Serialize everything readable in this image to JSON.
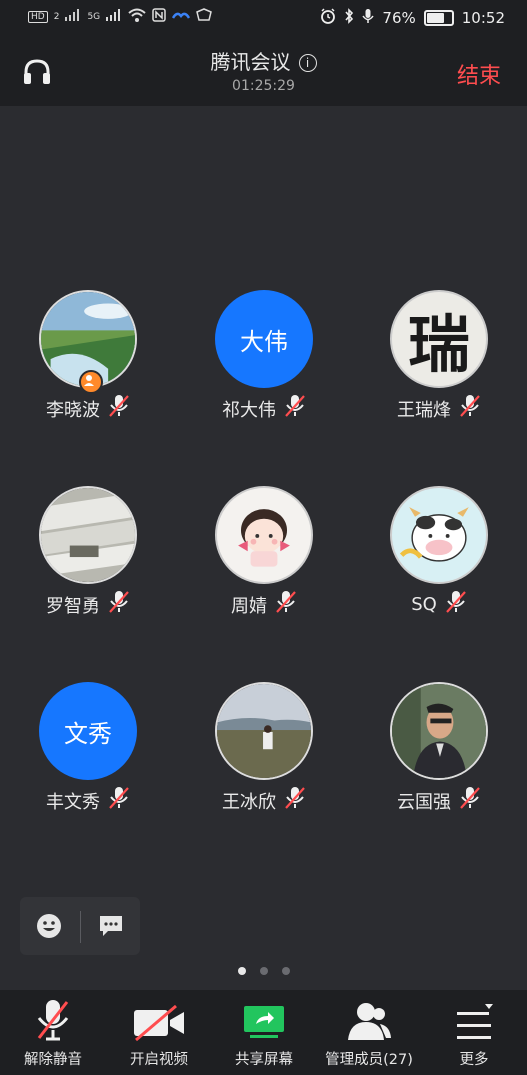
{
  "status_bar": {
    "left": [
      "HD",
      "2",
      "5G"
    ],
    "battery": "76%",
    "battery_level": 0.76,
    "time": "10:52"
  },
  "header": {
    "title": "腾讯会议",
    "timer": "01:25:29",
    "end_label": "结束",
    "info_glyph": "i"
  },
  "participants": [
    {
      "name": "李晓波",
      "avatar": "photo-landscape",
      "host": true
    },
    {
      "name": "祁大伟",
      "avatar_text": "大伟"
    },
    {
      "name": "王瑞烽",
      "avatar": "calligraphy",
      "avatar_text": "瑞"
    },
    {
      "name": "罗智勇",
      "avatar": "photo-greenhouse"
    },
    {
      "name": "周婧",
      "avatar": "cartoon-girl"
    },
    {
      "name": "SQ",
      "avatar": "cartoon-cow"
    },
    {
      "name": "丰文秀",
      "avatar_text": "文秀"
    },
    {
      "name": "王冰欣",
      "avatar": "photo-lake"
    },
    {
      "name": "云国强",
      "avatar": "photo-man"
    }
  ],
  "toolbar": [
    {
      "label": "解除静音",
      "icon": "mic-muted-icon"
    },
    {
      "label": "开启视频",
      "icon": "video-off-icon"
    },
    {
      "label": "共享屏幕",
      "icon": "share-screen-icon"
    },
    {
      "label": "管理成员(27)",
      "icon": "members-icon"
    },
    {
      "label": "更多",
      "icon": "more-icon"
    }
  ],
  "pager": {
    "pages": 3,
    "current": 1
  },
  "colors": {
    "accent": "#1677ff",
    "end": "#ff4d4f",
    "share": "#22c55e",
    "mute_slash": "#ff4d4f",
    "host_badge": "#ff8a2b"
  }
}
